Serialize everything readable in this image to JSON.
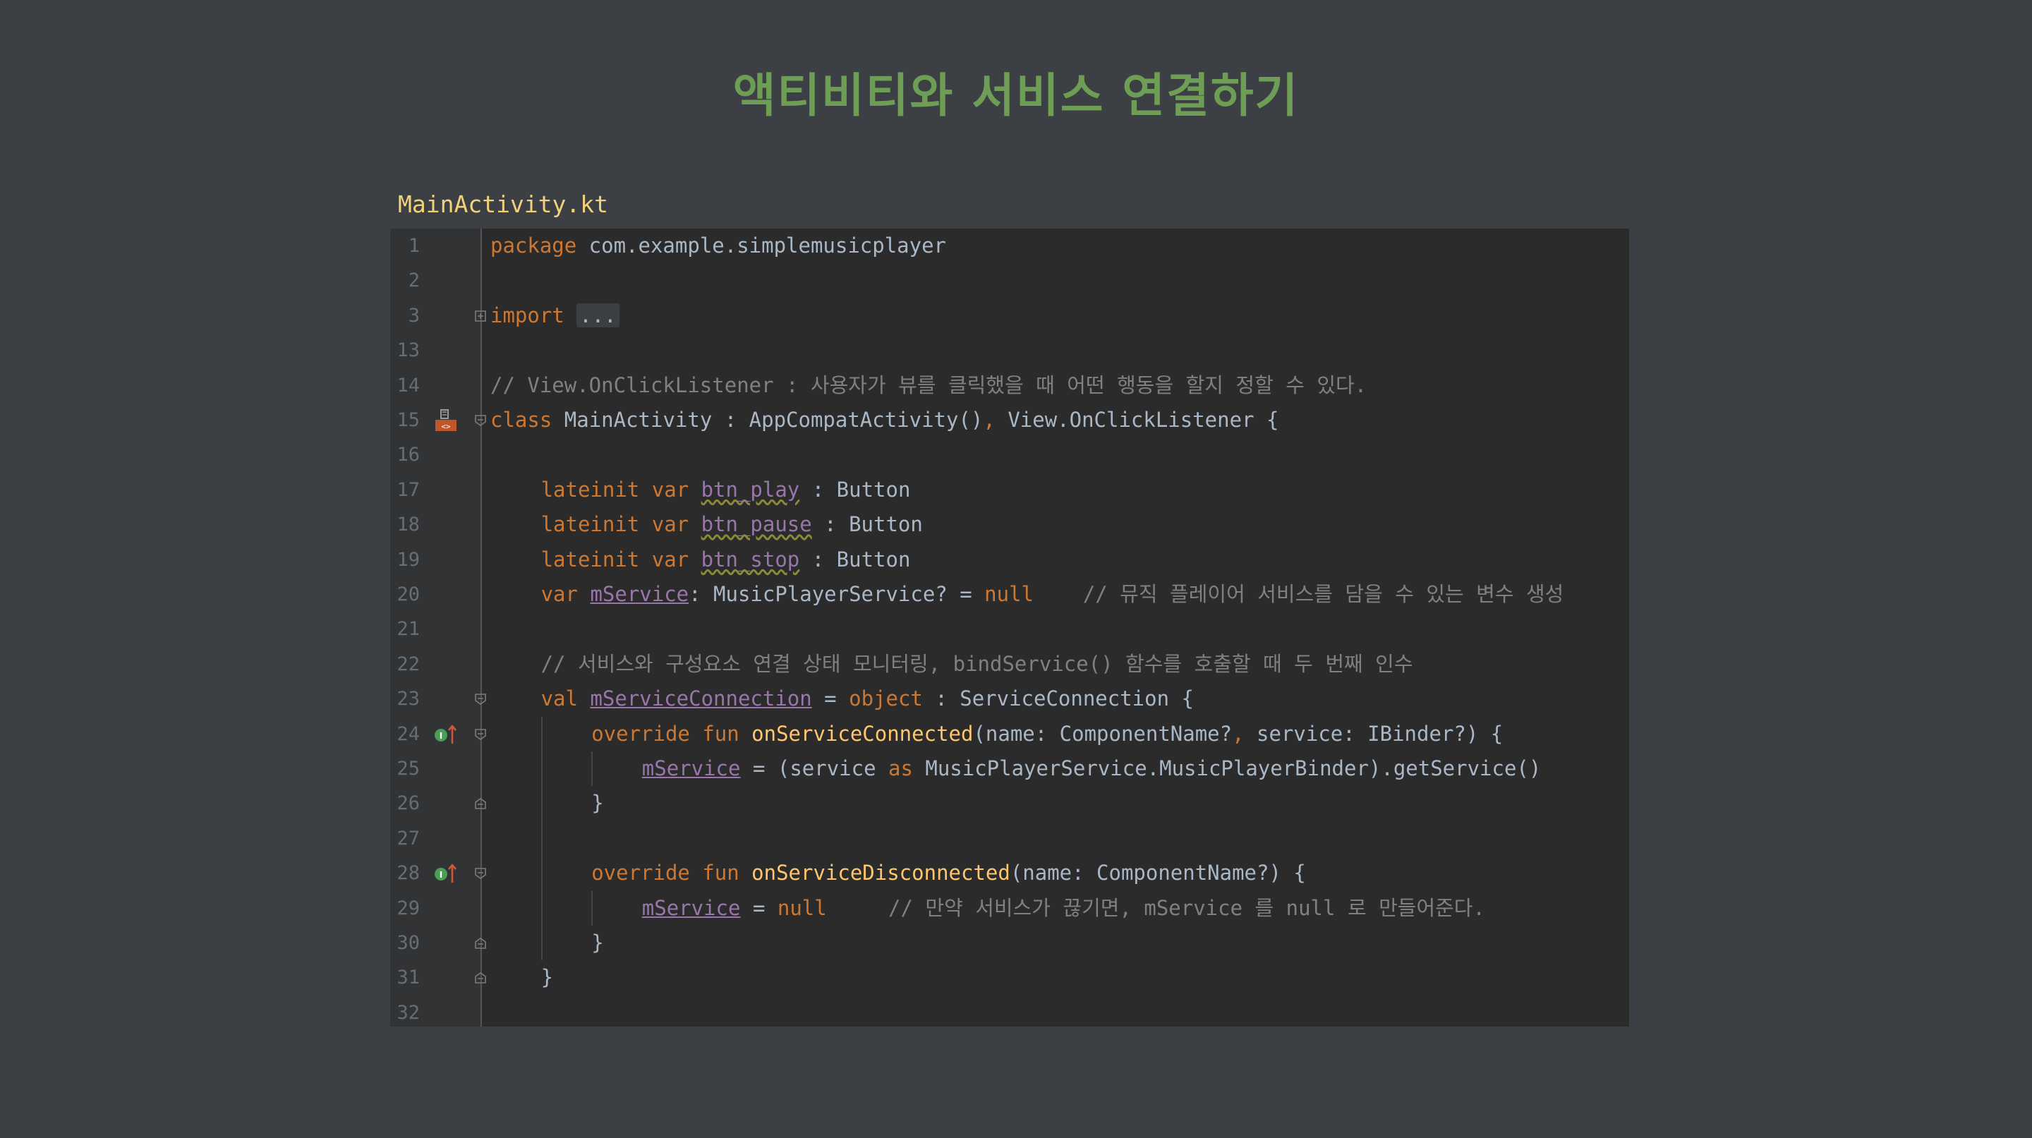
{
  "slide": {
    "title": "액티비티와 서비스 연결하기"
  },
  "file_tab": {
    "name": "MainActivity.kt"
  },
  "editor": {
    "lines": [
      {
        "n": "1",
        "indent": 0,
        "segs": [
          [
            "kw",
            "package"
          ],
          [
            "pl",
            " com.example.simplemusicplayer"
          ]
        ]
      },
      {
        "n": "2",
        "indent": 0,
        "segs": []
      },
      {
        "n": "3",
        "indent": 0,
        "fold": "closed",
        "segs": [
          [
            "kw",
            "import"
          ],
          [
            "pl",
            " "
          ],
          [
            "folded",
            "..."
          ]
        ]
      },
      {
        "n": "13",
        "indent": 0,
        "segs": []
      },
      {
        "n": "14",
        "indent": 0,
        "segs": [
          [
            "cm",
            "// View.OnClickListener : 사용자가 뷰를 클릭했을 때 어떤 행동을 할지 정할 수 있다."
          ]
        ]
      },
      {
        "n": "15",
        "indent": 0,
        "fold": "open",
        "icon": "class-layout-icon",
        "segs": [
          [
            "kw",
            "class"
          ],
          [
            "pl",
            " MainActivity : AppCompatActivity()"
          ],
          [
            "kw",
            ","
          ],
          [
            "pl",
            " View.OnClickListener {"
          ]
        ]
      },
      {
        "n": "16",
        "indent": 0,
        "segs": []
      },
      {
        "n": "17",
        "indent": 4,
        "segs": [
          [
            "kw",
            "lateinit var "
          ],
          [
            "wavy",
            "btn_play"
          ],
          [
            "pl",
            " : Button"
          ]
        ]
      },
      {
        "n": "18",
        "indent": 4,
        "segs": [
          [
            "kw",
            "lateinit var "
          ],
          [
            "wavy",
            "btn_pause"
          ],
          [
            "pl",
            " : Button"
          ]
        ]
      },
      {
        "n": "19",
        "indent": 4,
        "segs": [
          [
            "kw",
            "lateinit var "
          ],
          [
            "wavy",
            "btn_stop"
          ],
          [
            "pl",
            " : Button"
          ]
        ]
      },
      {
        "n": "20",
        "indent": 4,
        "segs": [
          [
            "kw",
            "var "
          ],
          [
            "prop",
            "mService"
          ],
          [
            "pl",
            ": MusicPlayerService? = "
          ],
          [
            "kw",
            "null"
          ],
          [
            "pl",
            "    "
          ],
          [
            "cm",
            "// 뮤직 플레이어 서비스를 담을 수 있는 변수 생성"
          ]
        ]
      },
      {
        "n": "21",
        "indent": 0,
        "segs": []
      },
      {
        "n": "22",
        "indent": 4,
        "segs": [
          [
            "cm",
            "// 서비스와 구성요소 연결 상태 모니터링, bindService() 함수를 호출할 때 두 번째 인수"
          ]
        ]
      },
      {
        "n": "23",
        "indent": 4,
        "fold": "open",
        "segs": [
          [
            "kw",
            "val "
          ],
          [
            "prop",
            "mServiceConnection"
          ],
          [
            "pl",
            " = "
          ],
          [
            "kw",
            "object"
          ],
          [
            "pl",
            " : ServiceConnection {"
          ]
        ]
      },
      {
        "n": "24",
        "indent": 8,
        "fold": "open",
        "icon": "override-icon",
        "segs": [
          [
            "kw",
            "override fun "
          ],
          [
            "fn",
            "onServiceConnected"
          ],
          [
            "pl",
            "(name: ComponentName?"
          ],
          [
            "kw",
            ","
          ],
          [
            "pl",
            " service: IBinder?) {"
          ]
        ]
      },
      {
        "n": "25",
        "indent": 12,
        "segs": [
          [
            "prop",
            "mService"
          ],
          [
            "pl",
            " = (service "
          ],
          [
            "kw",
            "as"
          ],
          [
            "pl",
            " MusicPlayerService.MusicPlayerBinder).getService()"
          ]
        ]
      },
      {
        "n": "26",
        "indent": 8,
        "fold": "end",
        "segs": [
          [
            "pl",
            "}"
          ]
        ]
      },
      {
        "n": "27",
        "indent": 0,
        "segs": []
      },
      {
        "n": "28",
        "indent": 8,
        "fold": "open",
        "icon": "override-icon",
        "segs": [
          [
            "kw",
            "override fun "
          ],
          [
            "fn",
            "onServiceDisconnected"
          ],
          [
            "pl",
            "(name: ComponentName?) {"
          ]
        ]
      },
      {
        "n": "29",
        "indent": 12,
        "segs": [
          [
            "prop",
            "mService"
          ],
          [
            "pl",
            " = "
          ],
          [
            "kw",
            "null"
          ],
          [
            "pl",
            "     "
          ],
          [
            "cm",
            "// 만약 서비스가 끊기면, mService 를 null 로 만들어준다."
          ]
        ]
      },
      {
        "n": "30",
        "indent": 8,
        "fold": "end",
        "segs": [
          [
            "pl",
            "}"
          ]
        ]
      },
      {
        "n": "31",
        "indent": 4,
        "fold": "end",
        "segs": [
          [
            "pl",
            "}"
          ]
        ]
      },
      {
        "n": "32",
        "indent": 0,
        "segs": []
      }
    ]
  }
}
